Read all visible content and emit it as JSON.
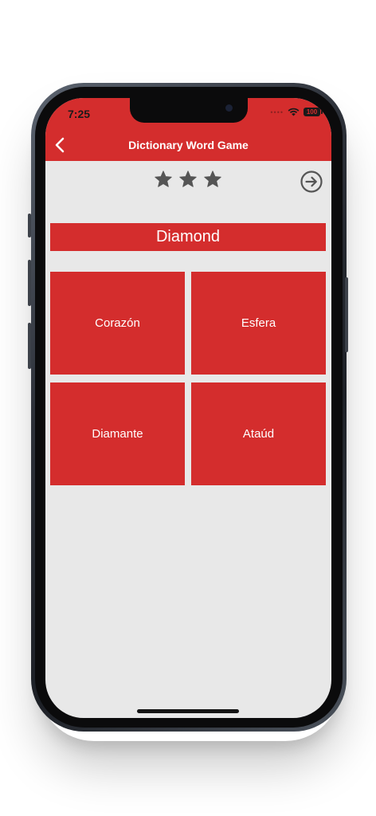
{
  "status_bar": {
    "time": "7:25",
    "signal_icon": "signal-dots-icon",
    "wifi_icon": "wifi-icon",
    "battery": "100"
  },
  "nav": {
    "title": "Dictionary Word Game",
    "back_icon": "chevron-left-icon"
  },
  "progress": {
    "stars_total": 3,
    "stars_filled": 3,
    "star_color": "#555555",
    "next_icon": "arrow-right-circle-icon"
  },
  "question": {
    "word": "Diamond"
  },
  "choices": [
    {
      "label": "Corazón"
    },
    {
      "label": "Esfera"
    },
    {
      "label": "Diamante"
    },
    {
      "label": "Ataúd"
    }
  ],
  "colors": {
    "accent": "#d42d2d",
    "background": "#e8e8e8",
    "on_accent_text": "#ffffff"
  }
}
